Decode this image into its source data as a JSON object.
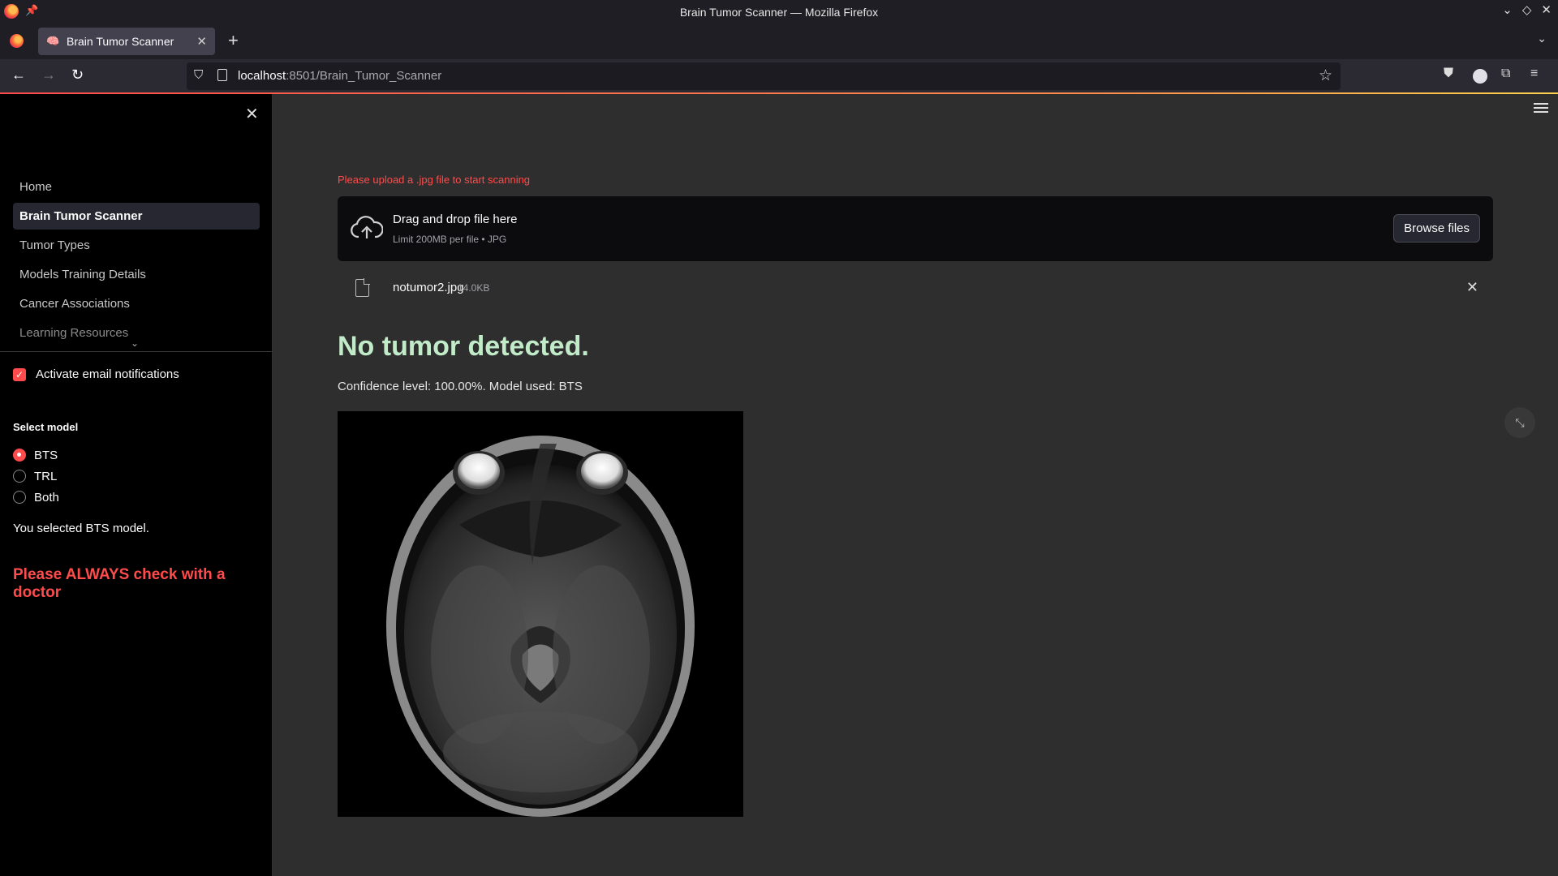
{
  "browser": {
    "window_title": "Brain Tumor Scanner — Mozilla Firefox",
    "tab_title": "Brain Tumor Scanner",
    "tab_favicon": "🧠",
    "url_host": "localhost",
    "url_path": ":8501/Brain_Tumor_Scanner"
  },
  "sidebar": {
    "nav_items": [
      {
        "label": "Home"
      },
      {
        "label": "Brain Tumor Scanner",
        "active": true
      },
      {
        "label": "Tumor Types"
      },
      {
        "label": "Models Training Details"
      },
      {
        "label": "Cancer Associations"
      },
      {
        "label": "Learning Resources"
      }
    ],
    "email_notifications": {
      "label": "Activate email notifications",
      "checked": true
    },
    "model_select": {
      "label": "Select model",
      "options": [
        "BTS",
        "TRL",
        "Both"
      ],
      "selected": "BTS"
    },
    "selection_text": "You selected BTS model.",
    "warning": "Please ALWAYS check with a doctor"
  },
  "main": {
    "upload_hint": "Please upload a .jpg file to start scanning",
    "dropzone": {
      "title": "Drag and drop file here",
      "limit": "Limit 200MB per file • JPG",
      "browse_label": "Browse files"
    },
    "file": {
      "name": "notumor2.jpg",
      "size": "14.0KB"
    },
    "result_title": "No tumor detected.",
    "confidence": "Confidence level: 100.00%. Model used: BTS"
  },
  "colors": {
    "accent": "#ff4b4b",
    "result_green": "#c2ebc9",
    "sidebar_bg": "#000000",
    "main_bg": "#2e2e2e"
  }
}
